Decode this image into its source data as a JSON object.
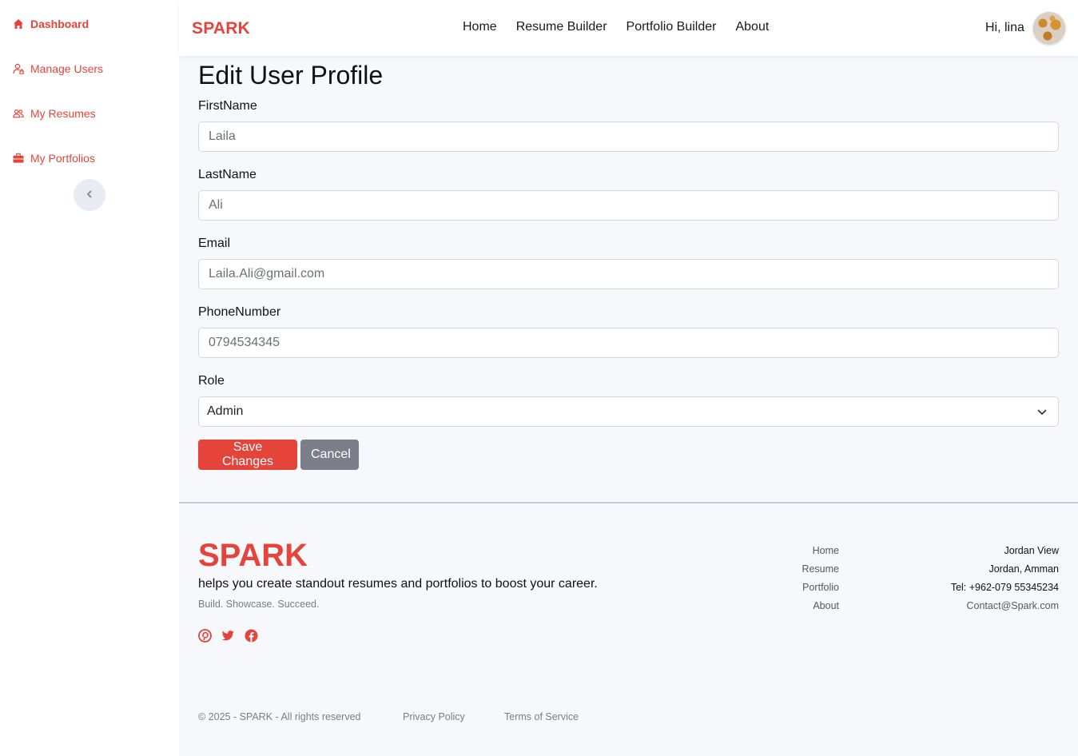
{
  "colors": {
    "accent": "#e5443a",
    "cancel": "#7c7f8a",
    "background": "#f7f8fb"
  },
  "sidebar": {
    "items": [
      {
        "label": "Dashboard",
        "icon": "home-icon",
        "active": true
      },
      {
        "label": "Manage Users",
        "icon": "user-lock-icon"
      },
      {
        "label": "My Resumes",
        "icon": "users-icon"
      },
      {
        "label": "My Portfolios",
        "icon": "briefcase-icon"
      }
    ],
    "collapse_icon": "chevron-left-icon"
  },
  "header": {
    "brand": "SPARK",
    "nav": [
      "Home",
      "Resume Builder",
      "Portfolio Builder",
      "About"
    ],
    "greeting": "Hi, lina"
  },
  "form": {
    "title": "Edit User Profile",
    "fields": [
      {
        "label": "FirstName",
        "value": "Laila"
      },
      {
        "label": "LastName",
        "value": "Ali"
      },
      {
        "label": "Email",
        "value": "Laila.Ali@gmail.com"
      },
      {
        "label": "PhoneNumber",
        "value": "0794534345"
      }
    ],
    "role": {
      "label": "Role",
      "value": "Admin"
    },
    "save_label": "Save Changes",
    "cancel_label": "Cancel"
  },
  "footer": {
    "brand": "SPARK",
    "tagline": "helps you create standout resumes and portfolios to boost your career.",
    "subtitle": "Build. Showcase. Succeed.",
    "social": [
      "pinterest-icon",
      "twitter-icon",
      "facebook-icon"
    ],
    "links": [
      "Home",
      "Resume",
      "Portfolio",
      "About"
    ],
    "contact": {
      "place": "Jordan View",
      "city": "Jordan, Amman",
      "tel": "Tel: +962-079 55345234",
      "email": "Contact@Spark.com"
    },
    "copyright": "© 2025 - SPARK - All rights reserved",
    "privacy": "Privacy Policy",
    "terms": "Terms of Service"
  }
}
